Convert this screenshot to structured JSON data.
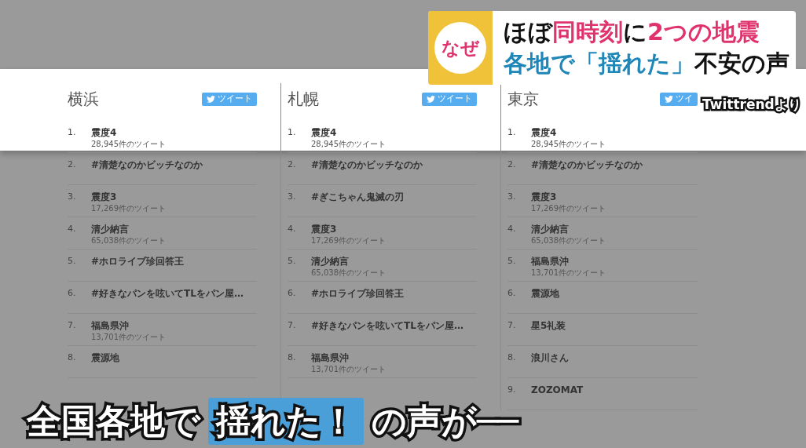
{
  "columns": [
    {
      "city": "横浜",
      "tweet_button": "ツイート",
      "trends": [
        {
          "rank": "1.",
          "title": "震度4",
          "count": "28,945件のツイート"
        },
        {
          "rank": "2.",
          "title": "#清楚なのかビッチなのか"
        },
        {
          "rank": "3.",
          "title": "震度3",
          "count": "17,269件のツイート"
        },
        {
          "rank": "4.",
          "title": "清少納言",
          "count": "65,038件のツイート"
        },
        {
          "rank": "5.",
          "title": "#ホロライブ珍回答王"
        },
        {
          "rank": "6.",
          "title": "#好きなパンを呟いてTLをパン屋…"
        },
        {
          "rank": "7.",
          "title": "福島県沖",
          "count": "13,701件のツイート"
        },
        {
          "rank": "8.",
          "title": "震源地"
        }
      ]
    },
    {
      "city": "札幌",
      "tweet_button": "ツイート",
      "trends": [
        {
          "rank": "1.",
          "title": "震度4",
          "count": "28,945件のツイート"
        },
        {
          "rank": "2.",
          "title": "#清楚なのかビッチなのか"
        },
        {
          "rank": "3.",
          "title": "#ぎこちゃん鬼滅の刃"
        },
        {
          "rank": "4.",
          "title": "震度3",
          "count": "17,269件のツイート"
        },
        {
          "rank": "5.",
          "title": "清少納言",
          "count": "65,038件のツイート"
        },
        {
          "rank": "6.",
          "title": "#ホロライブ珍回答王"
        },
        {
          "rank": "7.",
          "title": "#好きなパンを呟いてTLをパン屋…"
        },
        {
          "rank": "8.",
          "title": "福島県沖",
          "count": "13,701件のツイート"
        }
      ]
    },
    {
      "city": "東京",
      "tweet_button": "ツイ",
      "trends": [
        {
          "rank": "1.",
          "title": "震度4",
          "count": "28,945件のツイート"
        },
        {
          "rank": "2.",
          "title": "#清楚なのかビッチなのか"
        },
        {
          "rank": "3.",
          "title": "震度3",
          "count": "17,269件のツイート"
        },
        {
          "rank": "4.",
          "title": "清少納言",
          "count": "65,038件のツイート"
        },
        {
          "rank": "5.",
          "title": "福島県沖",
          "count": "13,701件のツイート"
        },
        {
          "rank": "6.",
          "title": "震源地"
        },
        {
          "rank": "7.",
          "title": "星5礼装"
        },
        {
          "rank": "8.",
          "title": "浪川さん"
        },
        {
          "rank": "9.",
          "title": "ZOZOMAT"
        }
      ]
    }
  ],
  "headline": {
    "badge": "なぜ",
    "lines": [
      [
        {
          "text": "ほぼ",
          "color": "#111111"
        },
        {
          "text": "同時刻",
          "color": "#e0336e"
        },
        {
          "text": "に",
          "color": "#111111"
        },
        {
          "text": "2つの地震",
          "color": "#e0336e"
        }
      ],
      [
        {
          "text": "各地で「揺れた」",
          "color": "#1f86b8"
        },
        {
          "text": "不安の声",
          "color": "#111111"
        }
      ]
    ]
  },
  "source": "Twittrendより",
  "caption": [
    {
      "text": "全国各地で",
      "highlight": false
    },
    {
      "text": "揺れた！",
      "highlight": true
    },
    {
      "text": "の声が──",
      "highlight": false
    }
  ]
}
